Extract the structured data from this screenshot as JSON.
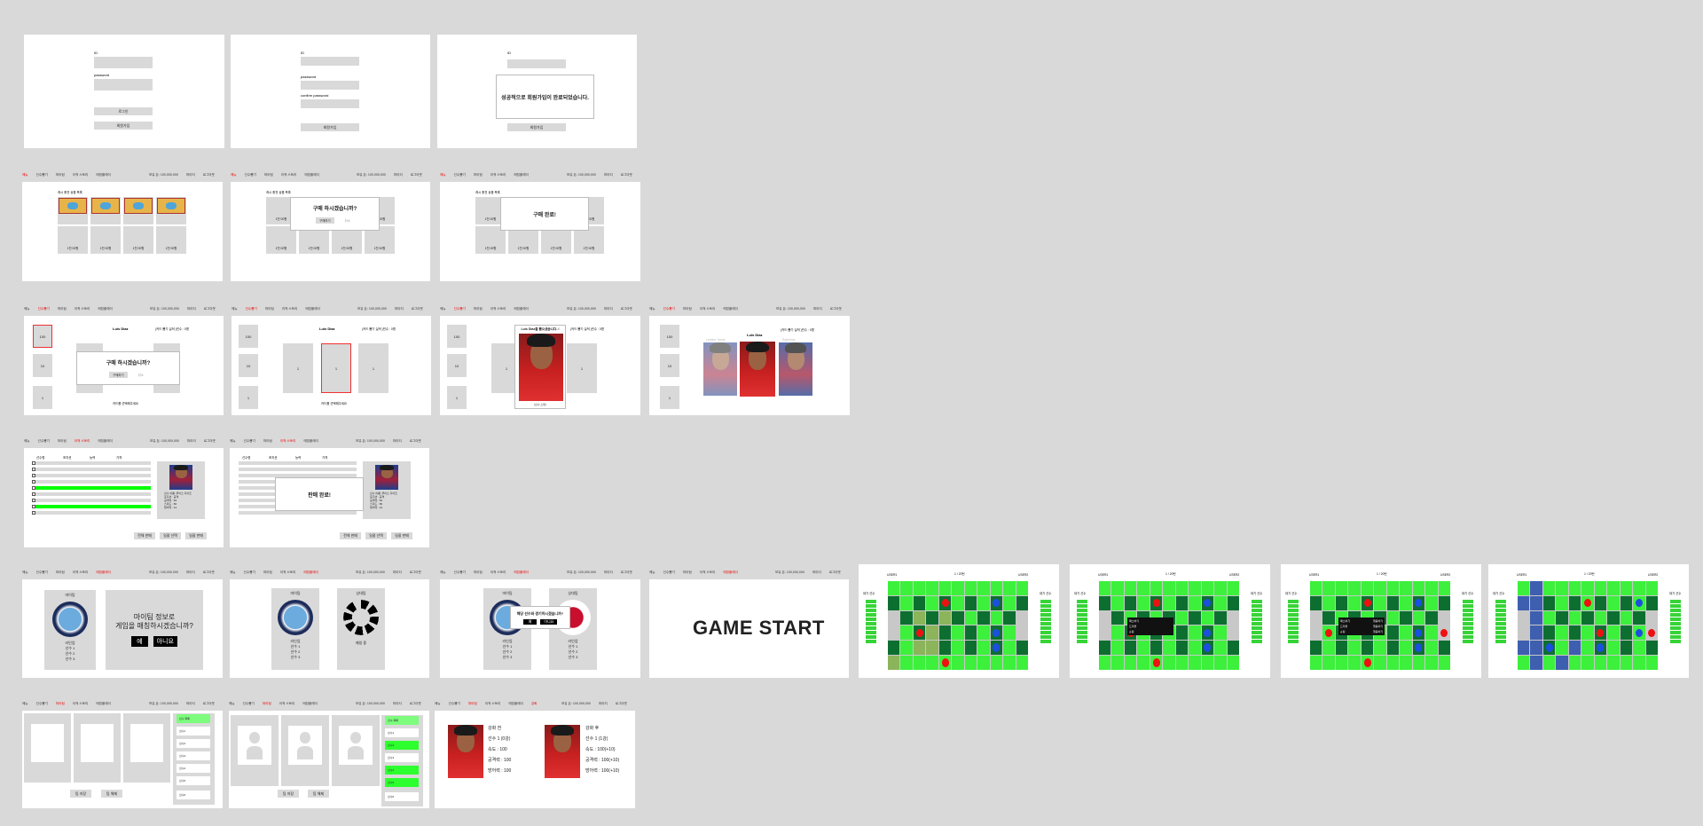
{
  "nav": {
    "items": [
      "메뉴",
      "선수뽑기",
      "마이팀",
      "이적 스토리",
      "매칭플레이"
    ],
    "money": "보유 돈: 100,000,000",
    "mypage": "마이티",
    "logout": "로그아웃",
    "history": "강화"
  },
  "auth": {
    "id": "ID",
    "password": "password",
    "confirm": "confirm password",
    "login": "로그인",
    "signup": "회원가입",
    "success": "성공적으로 회원가입이 완료되었습니다."
  },
  "shop": {
    "title": "캐시 충전 상품 목록",
    "item": "1천 00원",
    "buy_q": "구매 하시겠습니까?",
    "buy_yes": "구매하기",
    "buy_no": "취소",
    "done": "구매 완료!"
  },
  "gacha": {
    "player": "Luis Diaz",
    "notice": "(카드 뽑기 실적 )민수 : 0명",
    "tiles": [
      "100",
      "10",
      "1"
    ],
    "pick": "카드를 선택해주세요",
    "num": "1",
    "reveal": "Luis Diaz를 뽑으셨습니다..!",
    "reveal_name": "(선수 스탯)",
    "left_name": "Lamine Yamal",
    "right_name": "Raphinha"
  },
  "store": {
    "cols": [
      "선수명",
      "포지션",
      "능력",
      "가격",
      "소유"
    ],
    "stats": [
      "선수 이름: 루이스 디아즈",
      "포지션 : 공격",
      "공격력 : 84",
      "스피드 : 86",
      "방어력 : 44"
    ],
    "sell_all": "전체 판매",
    "select": "일괄 선택",
    "sell": "일괄 판매",
    "sold": "판매 완료!"
  },
  "match": {
    "myteam": "마이팀",
    "enemy": "상대팀",
    "lineup": "라인업",
    "players": [
      "선수 1",
      "선수 2",
      "선수 3"
    ],
    "ask": "마이팀 정보로\n게임을 매칭하시겠습니까?",
    "yes": "예",
    "no": "아니요",
    "searching": "매칭 중",
    "ask2": "해당 선수와 경기하시겠습니까?",
    "start": "GAME START"
  },
  "game": {
    "user1": "USER1",
    "user2": "USER2",
    "turn": "1 / 20턴",
    "bench1": "대기 선수",
    "bench2": "대기 선수",
    "menu": [
      "패스하기",
      "드리블",
      "슈팅"
    ],
    "menu_right": [
      "행동하기",
      "행동하기",
      "행동하기"
    ]
  },
  "team": {
    "title": "선수 목록",
    "list": [
      "선수1",
      "선수2",
      "선수3",
      "선수4",
      "선수5",
      "선수6",
      "선수7"
    ],
    "save": "팀 저장",
    "reset": "팀 해제"
  },
  "upgrade": {
    "left": [
      "강화 전",
      "선수 1 (0강)",
      "속도 : 100",
      "공격력 : 100",
      "방어력 : 100"
    ],
    "right": [
      "강화 후",
      "선수 1 (1강)",
      "속도 : 100(+10)",
      "공격력 : 100(+10)",
      "방어력 : 100(+10)"
    ]
  },
  "colors": {
    "bg": "#d9d9d9",
    "active": "#ff0000",
    "field": "#3cf03c",
    "dark": "#0c6f30"
  }
}
